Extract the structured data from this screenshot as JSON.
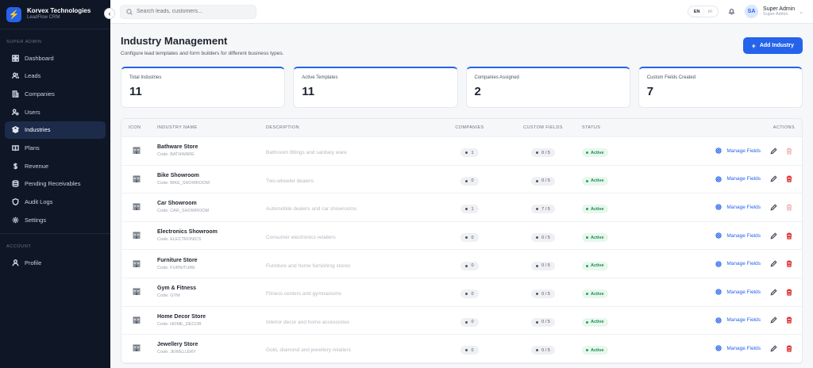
{
  "brand": {
    "name": "Korvex Technologies",
    "sub": "LeadFlow CRM"
  },
  "sidebar": {
    "section_main": "SUPER ADMIN",
    "items": [
      {
        "label": "Dashboard",
        "icon": "dashboard-icon"
      },
      {
        "label": "Leads",
        "icon": "users-icon"
      },
      {
        "label": "Companies",
        "icon": "building-icon"
      },
      {
        "label": "Users",
        "icon": "user-gear-icon"
      },
      {
        "label": "Industries",
        "icon": "layers-icon",
        "active": true
      },
      {
        "label": "Plans",
        "icon": "book-icon"
      },
      {
        "label": "Revenue",
        "icon": "dollar-icon"
      },
      {
        "label": "Pending Receivables",
        "icon": "database-icon"
      },
      {
        "label": "Audit Logs",
        "icon": "shield-icon"
      },
      {
        "label": "Settings",
        "icon": "gear-icon"
      }
    ],
    "section_account": "ACCOUNT",
    "account_items": [
      {
        "label": "Profile",
        "icon": "user-icon"
      }
    ]
  },
  "topbar": {
    "search_placeholder": "Search leads, customers...",
    "lang_en": "EN",
    "lang_hi": "HI",
    "avatar_initials": "SA",
    "user_name": "Super Admin",
    "user_role": "Super Admin"
  },
  "page": {
    "title": "Industry Management",
    "subtitle": "Configure lead templates and form builders for different business types.",
    "add_button": "Add Industry"
  },
  "stats": [
    {
      "label": "Total Industries",
      "value": "11"
    },
    {
      "label": "Active Templates",
      "value": "11"
    },
    {
      "label": "Companies Assigned",
      "value": "2"
    },
    {
      "label": "Custom Fields Created",
      "value": "7"
    }
  ],
  "table": {
    "headers": {
      "icon": "ICON",
      "name": "INDUSTRY NAME",
      "description": "DESCRIPTION",
      "companies": "COMPANIES",
      "custom_fields": "CUSTOM FIELDS",
      "status": "STATUS",
      "actions": "ACTIONS"
    },
    "manage_label": "Manage Fields",
    "rows": [
      {
        "name": "Bathware Store",
        "code": "Code: BATHWARE",
        "description": "Bathroom fittings and sanitary ware",
        "companies": "1",
        "custom_fields": "0 / 5",
        "status": "Active",
        "can_delete": false
      },
      {
        "name": "Bike Showroom",
        "code": "Code: BIKE_SHOWROOM",
        "description": "Two-wheeler dealers",
        "companies": "0",
        "custom_fields": "0 / 5",
        "status": "Active",
        "can_delete": true
      },
      {
        "name": "Car Showroom",
        "code": "Code: CAR_SHOWROOM",
        "description": "Automobile dealers and car showrooms",
        "companies": "1",
        "custom_fields": "7 / 5",
        "status": "Active",
        "can_delete": false
      },
      {
        "name": "Electronics Showroom",
        "code": "Code: ELECTRONICS",
        "description": "Consumer electronics retailers",
        "companies": "0",
        "custom_fields": "0 / 5",
        "status": "Active",
        "can_delete": true
      },
      {
        "name": "Furniture Store",
        "code": "Code: FURNITURE",
        "description": "Furniture and home furnishing stores",
        "companies": "0",
        "custom_fields": "0 / 5",
        "status": "Active",
        "can_delete": true
      },
      {
        "name": "Gym & Fitness",
        "code": "Code: GYM",
        "description": "Fitness centers and gymnasiums",
        "companies": "0",
        "custom_fields": "0 / 5",
        "status": "Active",
        "can_delete": true
      },
      {
        "name": "Home Decor Store",
        "code": "Code: HOME_DECOR",
        "description": "Interior decor and home accessories",
        "companies": "0",
        "custom_fields": "0 / 5",
        "status": "Active",
        "can_delete": true
      },
      {
        "name": "Jewellery Store",
        "code": "Code: JEWELLERY",
        "description": "Gold, diamond and jewellery retailers",
        "companies": "0",
        "custom_fields": "0 / 5",
        "status": "Active",
        "can_delete": true
      }
    ]
  },
  "colors": {
    "accent": "#2563eb",
    "sidebar_bg": "#0f1626",
    "active_green": "#1a8a4a",
    "delete_red": "#dc2626"
  }
}
